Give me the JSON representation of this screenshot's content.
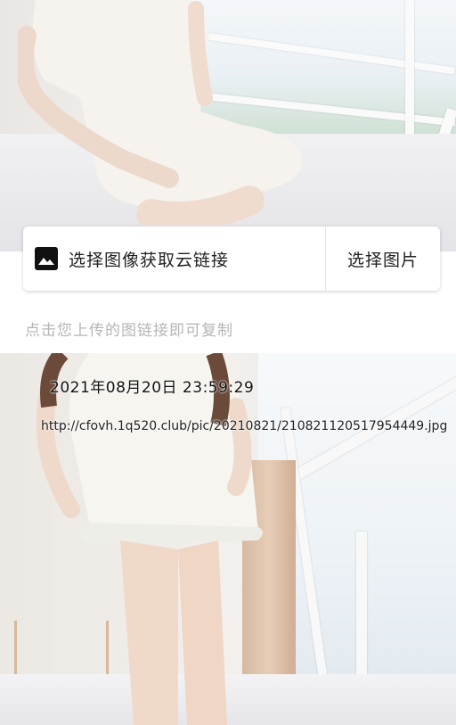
{
  "upload_card": {
    "icon": "image-icon",
    "title": "选择图像获取云链接",
    "pick_button": "选择图片"
  },
  "hint": "点击您上传的图链接即可复制",
  "uploaded_item": {
    "timestamp": "2021年08月20日 23:59:29",
    "link": "http://cfovh.1q520.club/pic/20210821/210821120517954449.jpg"
  }
}
